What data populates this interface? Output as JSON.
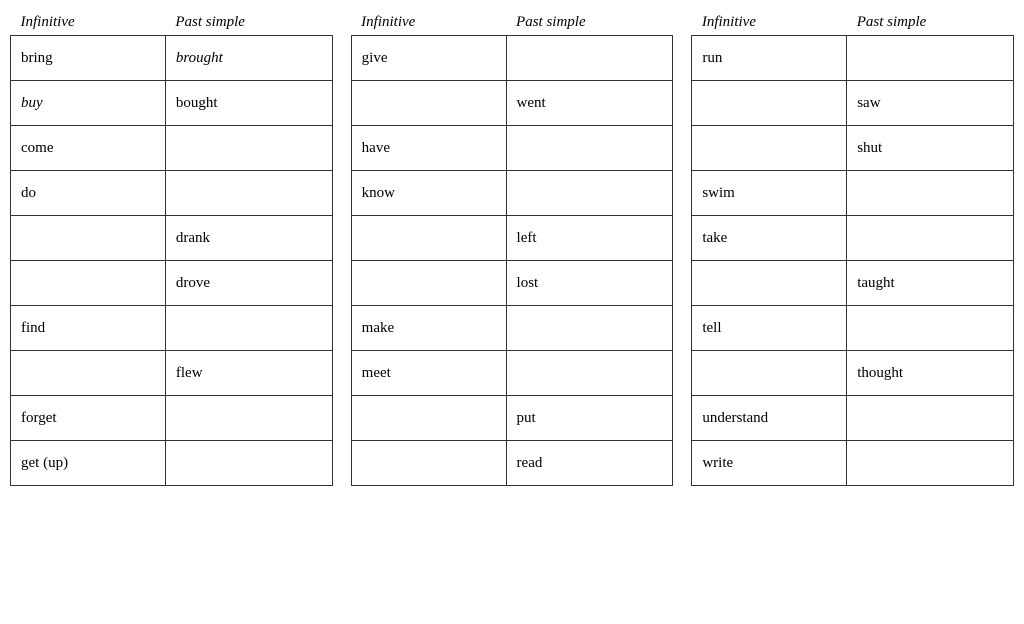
{
  "tables": [
    {
      "id": "table1",
      "headers": [
        "Infinitive",
        "Past simple"
      ],
      "rows": [
        {
          "infinitive": "bring",
          "past": "brought",
          "infinitive_italic": false,
          "past_italic": true
        },
        {
          "infinitive": "buy",
          "past": "bought",
          "infinitive_italic": true,
          "past_italic": false
        },
        {
          "infinitive": "come",
          "past": "",
          "infinitive_italic": false,
          "past_italic": false
        },
        {
          "infinitive": "do",
          "past": "",
          "infinitive_italic": false,
          "past_italic": false
        },
        {
          "infinitive": "",
          "past": "drank",
          "infinitive_italic": false,
          "past_italic": false
        },
        {
          "infinitive": "",
          "past": "drove",
          "infinitive_italic": false,
          "past_italic": false
        },
        {
          "infinitive": "find",
          "past": "",
          "infinitive_italic": false,
          "past_italic": false
        },
        {
          "infinitive": "",
          "past": "flew",
          "infinitive_italic": false,
          "past_italic": false
        },
        {
          "infinitive": "forget",
          "past": "",
          "infinitive_italic": false,
          "past_italic": false
        },
        {
          "infinitive": "get (up)",
          "past": "",
          "infinitive_italic": false,
          "past_italic": false
        }
      ]
    },
    {
      "id": "table2",
      "headers": [
        "Infinitive",
        "Past simple"
      ],
      "rows": [
        {
          "infinitive": "give",
          "past": "",
          "infinitive_italic": false,
          "past_italic": false
        },
        {
          "infinitive": "",
          "past": "went",
          "infinitive_italic": false,
          "past_italic": false
        },
        {
          "infinitive": "have",
          "past": "",
          "infinitive_italic": false,
          "past_italic": false
        },
        {
          "infinitive": "know",
          "past": "",
          "infinitive_italic": false,
          "past_italic": false
        },
        {
          "infinitive": "",
          "past": "left",
          "infinitive_italic": false,
          "past_italic": false
        },
        {
          "infinitive": "",
          "past": "lost",
          "infinitive_italic": false,
          "past_italic": false
        },
        {
          "infinitive": "make",
          "past": "",
          "infinitive_italic": false,
          "past_italic": false
        },
        {
          "infinitive": "meet",
          "past": "",
          "infinitive_italic": false,
          "past_italic": false
        },
        {
          "infinitive": "",
          "past": "put",
          "infinitive_italic": false,
          "past_italic": false
        },
        {
          "infinitive": "",
          "past": "read",
          "infinitive_italic": false,
          "past_italic": false
        }
      ]
    },
    {
      "id": "table3",
      "headers": [
        "Infinitive",
        "Past simple"
      ],
      "rows": [
        {
          "infinitive": "run",
          "past": "",
          "infinitive_italic": false,
          "past_italic": false
        },
        {
          "infinitive": "",
          "past": "saw",
          "infinitive_italic": false,
          "past_italic": false
        },
        {
          "infinitive": "",
          "past": "shut",
          "infinitive_italic": false,
          "past_italic": false
        },
        {
          "infinitive": "swim",
          "past": "",
          "infinitive_italic": false,
          "past_italic": false
        },
        {
          "infinitive": "take",
          "past": "",
          "infinitive_italic": false,
          "past_italic": false
        },
        {
          "infinitive": "",
          "past": "taught",
          "infinitive_italic": false,
          "past_italic": false
        },
        {
          "infinitive": "tell",
          "past": "",
          "infinitive_italic": false,
          "past_italic": false
        },
        {
          "infinitive": "",
          "past": "thought",
          "infinitive_italic": false,
          "past_italic": false
        },
        {
          "infinitive": "understand",
          "past": "",
          "infinitive_italic": false,
          "past_italic": false
        },
        {
          "infinitive": "write",
          "past": "",
          "infinitive_italic": false,
          "past_italic": false
        }
      ]
    }
  ]
}
